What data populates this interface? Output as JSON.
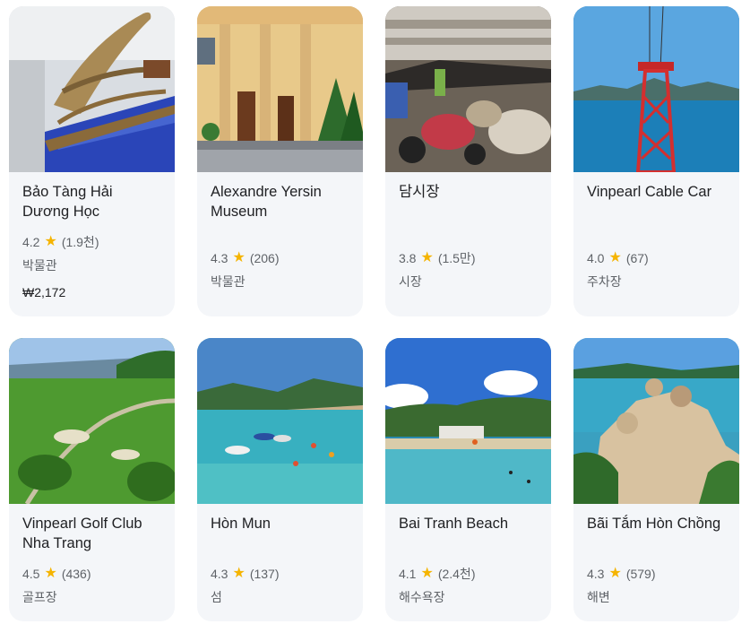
{
  "colors": {
    "card_bg": "#f4f6f9",
    "star": "#f5b400",
    "title": "#202124",
    "meta": "#5f6368"
  },
  "cards": [
    {
      "title": "Bảo Tàng Hải Dương Học",
      "rating": "4.2",
      "reviews": "(1.9천)",
      "category": "박물관",
      "price": "₩2,172",
      "image": "museum-whale-skeleton"
    },
    {
      "title": "Alexandre Yersin Museum",
      "rating": "4.3",
      "reviews": "(206)",
      "category": "박물관",
      "image": "museum-building"
    },
    {
      "title": "담시장",
      "rating": "3.8",
      "reviews": "(1.5만)",
      "category": "시장",
      "image": "market-scene"
    },
    {
      "title": "Vinpearl Cable Car",
      "rating": "4.0",
      "reviews": "(67)",
      "category": "주차장",
      "image": "cable-car-tower"
    },
    {
      "title": "Vinpearl Golf Club Nha Trang",
      "rating": "4.5",
      "reviews": "(436)",
      "category": "골프장",
      "image": "golf-course"
    },
    {
      "title": "Hòn Mun",
      "rating": "4.3",
      "reviews": "(137)",
      "category": "섬",
      "image": "island-boats"
    },
    {
      "title": "Bai Tranh Beach",
      "rating": "4.1",
      "reviews": "(2.4천)",
      "category": "해수욕장",
      "image": "beach"
    },
    {
      "title": "Bãi Tắm Hòn Chồng",
      "rating": "4.3",
      "reviews": "(579)",
      "category": "해변",
      "image": "rocky-coast"
    }
  ]
}
